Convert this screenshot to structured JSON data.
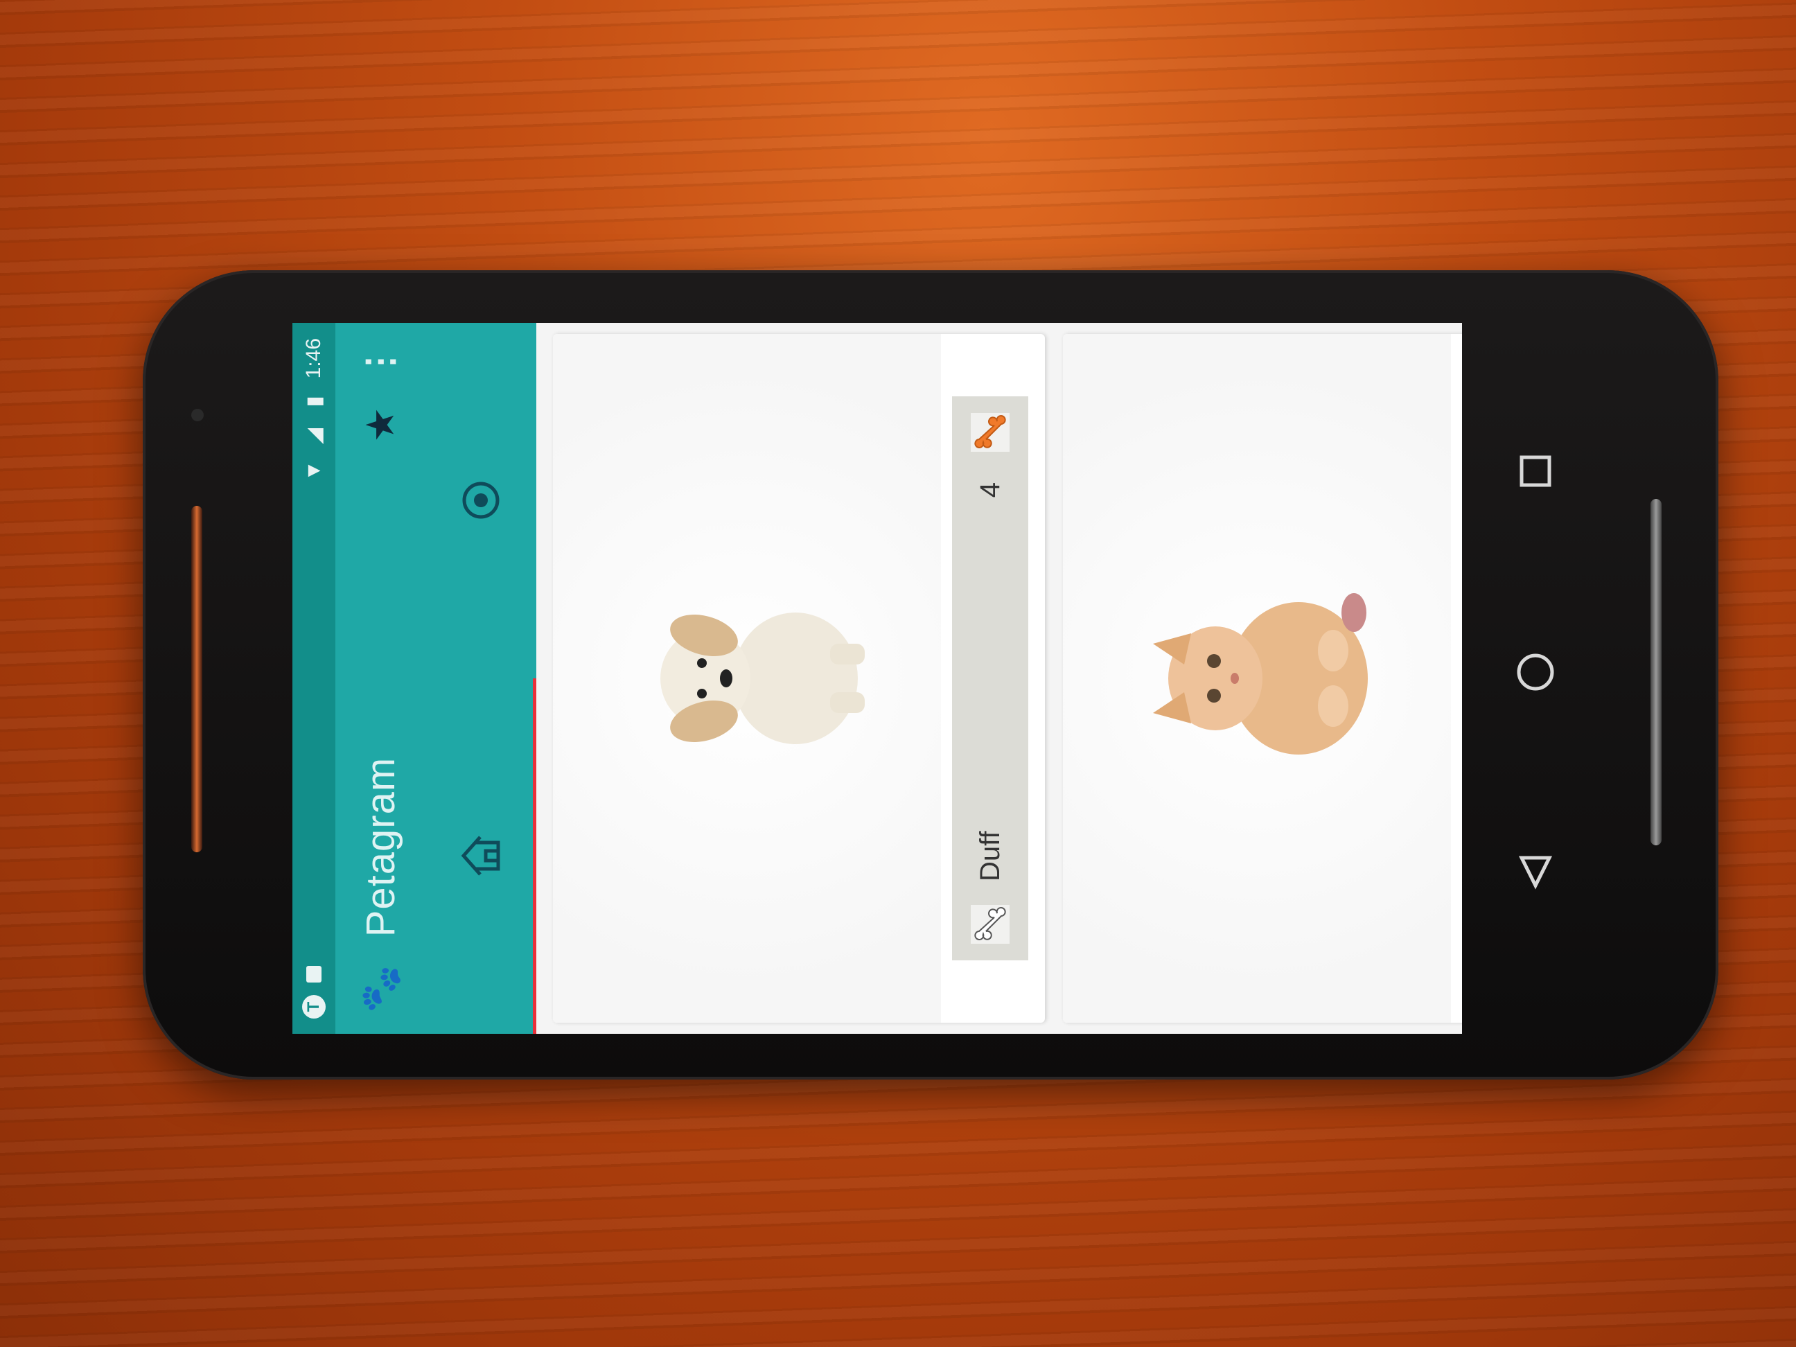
{
  "status_bar": {
    "time": "1:46"
  },
  "toolbar": {
    "title": "Petagram"
  },
  "pets": [
    {
      "name": "Duff",
      "likes": "4"
    },
    {
      "name": "",
      "likes": ""
    }
  ],
  "colors": {
    "primary": "#1fa8a6",
    "primary_dark": "#128e8a",
    "accent": "#e8303a"
  },
  "icons": [
    "paw-icon",
    "star-icon",
    "overflow-menu-icon",
    "home-tab-icon",
    "profile-tab-icon",
    "bone-icon",
    "bone-orange-icon",
    "back-nav-icon",
    "home-nav-icon",
    "recents-nav-icon"
  ]
}
